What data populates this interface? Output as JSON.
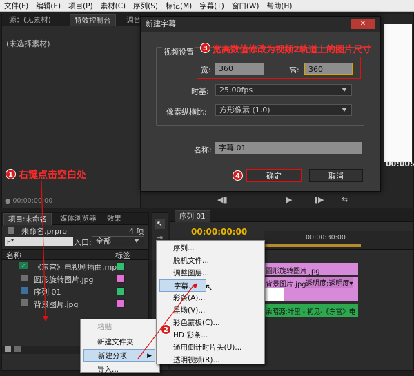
{
  "menubar": [
    "文件(F)",
    "编辑(E)",
    "项目(P)",
    "素材(C)",
    "序列(S)",
    "标记(M)",
    "字幕(T)",
    "窗口(W)",
    "帮助(H)"
  ],
  "source_panel": {
    "tabs": [
      "源：(无素材)",
      "特效控制台",
      "调音"
    ],
    "no_clip": "(未选择素材)",
    "timecode": "00:00:00:00"
  },
  "program_panel": {
    "timecode": "00:00:4"
  },
  "dialog": {
    "title": "新建字幕",
    "close": "✕",
    "video_settings": "视频设置",
    "width_label": "宽:",
    "width_value": "360",
    "height_label": "高:",
    "height_value": "360",
    "timebase_label": "时基:",
    "timebase_value": "25.00fps",
    "par_label": "像素纵横比:",
    "par_value": "方形像素 (1.0)",
    "name_label": "名称:",
    "name_value": "字幕 01",
    "ok": "确定",
    "cancel": "取消"
  },
  "annotations": {
    "a1_num": "1",
    "a1_text": "右键点击空白处",
    "a2_num": "2",
    "a3_num": "3",
    "a3_text": "宽高数值修改为视频2轨道上的图片尺寸",
    "a4_num": "4"
  },
  "project_panel": {
    "tabs": [
      "项目:未命名",
      "媒体浏览器",
      "效果"
    ],
    "project_file": "未命名.prproj",
    "item_count": "4 项",
    "search_placeholder": "ρ▾",
    "entry_label": "入口:",
    "entry_value": "全部",
    "col_name": "名称",
    "col_label": "标签",
    "items": [
      {
        "name": "《东宫》电视剧插曲.mp3",
        "color": "#2fbf6e"
      },
      {
        "name": "圆形旋转图片.jpg",
        "color": "#e46fd8"
      },
      {
        "name": "序列 01",
        "color": "#2fbf6e"
      },
      {
        "name": "背景图片.jpg",
        "color": "#e46fd8"
      }
    ]
  },
  "context_menu": {
    "paste": "粘贴",
    "new_bin": "新建文件夹",
    "new_item": "新建分项",
    "import": "导入..."
  },
  "submenu": [
    "序列...",
    "脱机文件...",
    "调整图层...",
    "字幕...",
    "彩条(A)...",
    "黑场(V)...",
    "彩色蒙板(C)...",
    "HD 彩条...",
    "通用倒计时片头(U)...",
    "透明视频(R)..."
  ],
  "timeline": {
    "tab": "序列 01",
    "timecode": "00:00:00:00",
    "ruler_mark": "00:00:30:00",
    "clip_circle": "圆形旋转图片.jpg",
    "clip_bg": "背景图片.jpg",
    "clip_opacity": "透明度:透明度▾",
    "clip_audio": "余昭源;叶里 - 初见-《东宫》电"
  },
  "colors": {
    "accent_red": "#ff2020",
    "timecode_yellow": "#e8b400",
    "clip_pink": "#d78ad9",
    "clip_green": "#2ea84f"
  }
}
